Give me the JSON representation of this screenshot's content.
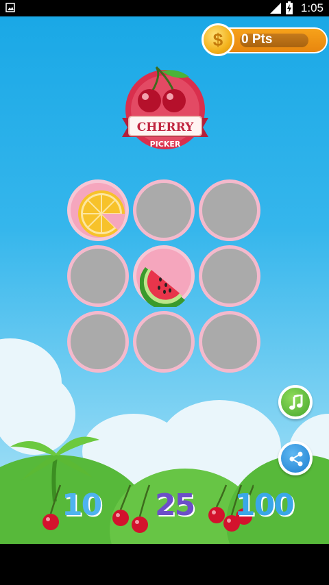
{
  "status_bar": {
    "time": "1:05"
  },
  "points": {
    "label": "0 Pts",
    "coin_symbol": "$"
  },
  "logo": {
    "title": "CHERRY",
    "subtitle": "PICKER"
  },
  "grid": {
    "rows": 3,
    "cols": 3,
    "cells": [
      "orange",
      "hidden",
      "hidden",
      "hidden",
      "watermelon",
      "hidden",
      "hidden",
      "hidden",
      "hidden"
    ]
  },
  "scores": [
    {
      "cherries": 1,
      "points": "10"
    },
    {
      "cherries": 2,
      "points": "25"
    },
    {
      "cherries": 3,
      "points": "100"
    }
  ],
  "buttons": {
    "music": "music-note-icon",
    "share": "share-icon"
  },
  "colors": {
    "sky": "#1aa8e6",
    "cell_hidden": "#aaaaaa",
    "cell_border": "#f4b9cc",
    "pts_orange": "#f7a21a"
  }
}
